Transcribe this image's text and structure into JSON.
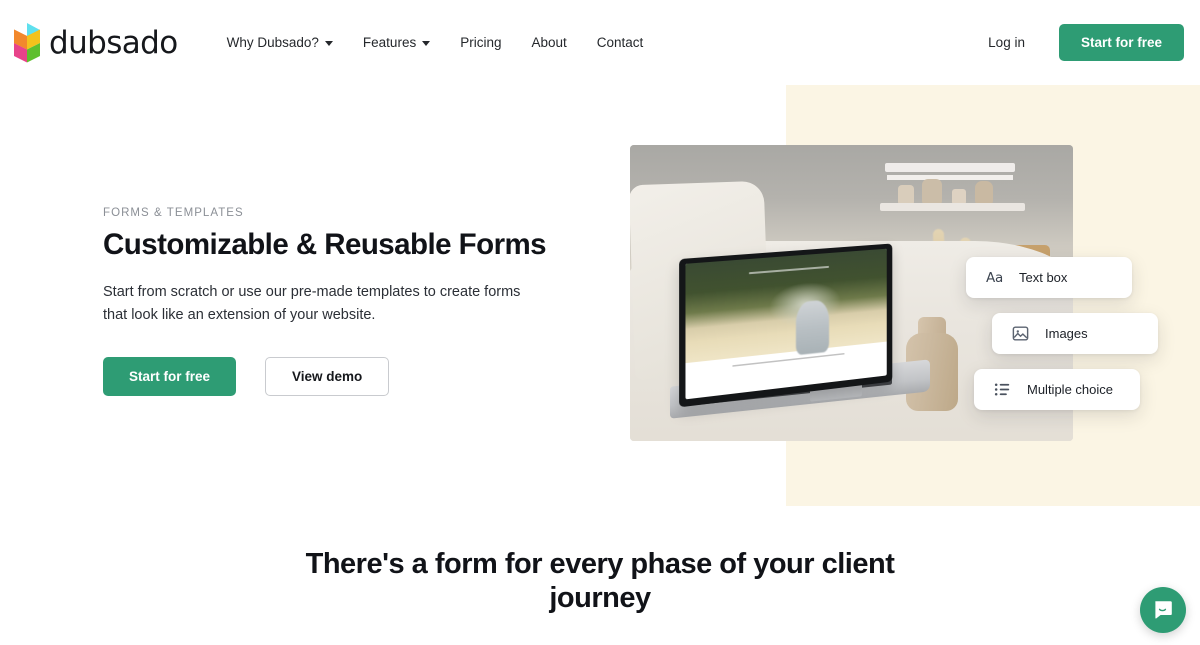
{
  "brand": {
    "word": "dubsado",
    "logo_icon": "dubsado-cube-logo",
    "colors": {
      "cyan": "#3ecfe8",
      "blue": "#3aa0e8",
      "orange": "#f58a2e",
      "yellow": "#f5c518",
      "magenta": "#e8437f",
      "purple": "#9a4bd6",
      "green": "#4caf3f",
      "lime": "#8bc926"
    }
  },
  "header": {
    "nav": [
      {
        "label": "Why Dubsado?",
        "has_caret": true
      },
      {
        "label": "Features",
        "has_caret": true
      },
      {
        "label": "Pricing",
        "has_caret": false
      },
      {
        "label": "About",
        "has_caret": false
      },
      {
        "label": "Contact",
        "has_caret": false
      }
    ],
    "login_label": "Log in",
    "cta_label": "Start for free",
    "cta_color": "#2e9c74"
  },
  "hero": {
    "eyebrow": "FORMS & TEMPLATES",
    "title": "Customizable & Reusable Forms",
    "subtitle": "Start from scratch or use our pre-made templates to create forms that look like an extension of your website.",
    "primary_cta": "Start for free",
    "secondary_cta": "View demo",
    "background_block_color": "#fbf5e4",
    "image_alt": "Laptop on a white couch showing a photography website, beside a vase of dried pampas grass",
    "feature_cards": [
      {
        "label": "Text box",
        "icon": "text-box-icon"
      },
      {
        "label": "Images",
        "icon": "image-icon"
      },
      {
        "label": "Multiple choice",
        "icon": "list-bullet-icon"
      }
    ]
  },
  "section": {
    "title": "There's a form for every phase of your client journey"
  },
  "chat": {
    "icon": "chat-bubble-icon",
    "color": "#2e9c74"
  }
}
